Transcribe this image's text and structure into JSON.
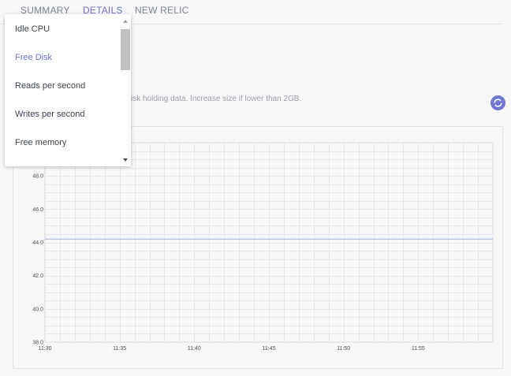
{
  "tabs": [
    {
      "label": "SUMMARY",
      "active": false
    },
    {
      "label": "DETAILS",
      "active": true
    },
    {
      "label": "NEW RELIC",
      "active": false
    }
  ],
  "metric_dropdown": {
    "items": [
      "Idle CPU",
      "Free Disk",
      "Reads per second",
      "Writes per second",
      "Free memory"
    ],
    "selected": "Free Disk"
  },
  "description": "isk holding data. Increase size if lower than 2GB.",
  "refresh_icon": "refresh-icon",
  "colors": {
    "accent": "#6c72d6",
    "series_line": "#aab0ee",
    "grid": "#e6e7ea"
  },
  "chart_data": {
    "type": "line",
    "x_ticks": [
      "11:30",
      "11:35",
      "11:40",
      "11:45",
      "11:50",
      "11:55"
    ],
    "y_ticks": [
      "38.0",
      "40.0",
      "42.0",
      "44.0",
      "46.0",
      "48.0"
    ],
    "xlim": [
      "11:30",
      "12:00"
    ],
    "ylim": [
      38.0,
      50.0
    ],
    "grid": true,
    "series": [
      {
        "x": [
          "11:30",
          "12:00"
        ],
        "values": [
          44.2,
          44.2
        ]
      }
    ]
  }
}
